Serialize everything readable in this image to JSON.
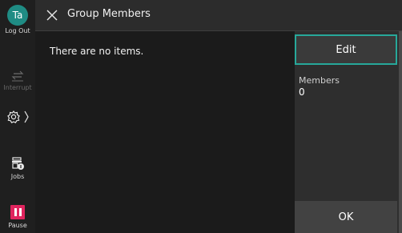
{
  "sidebar": {
    "user_initials": "Ta",
    "logout_label": "Log Out",
    "interrupt_label": "Interrupt",
    "jobs_label": "Jobs",
    "pause_label": "Pause"
  },
  "header": {
    "title": "Group Members"
  },
  "main": {
    "empty_message": "There are no items."
  },
  "right_panel": {
    "edit_label": "Edit",
    "members_label": "Members",
    "members_count": "0",
    "ok_label": "OK"
  },
  "colors": {
    "accent": "#27a89a",
    "avatar": "#1f8c84",
    "pause": "#e0245e"
  }
}
